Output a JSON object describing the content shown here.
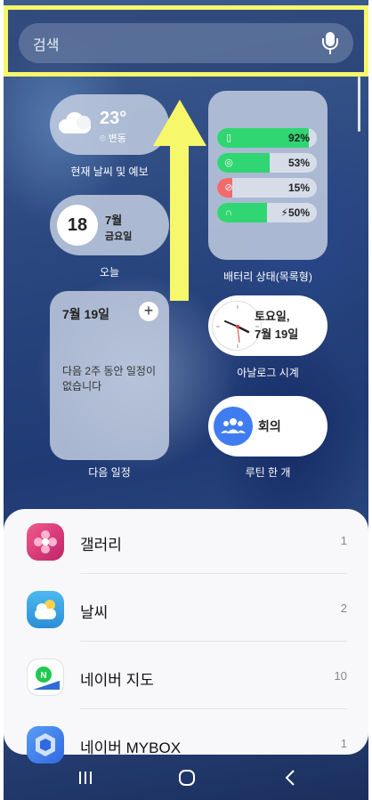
{
  "search": {
    "label": "검색",
    "mic_icon": "mic-icon"
  },
  "widgets": {
    "weather": {
      "temp": "23°",
      "location": "변동",
      "caption": "현재 날씨 및 예보"
    },
    "today": {
      "day": "18",
      "month": "7월",
      "weekday": "금요일",
      "caption": "오늘"
    },
    "schedule": {
      "title": "7월 19일",
      "add": "+",
      "empty": "다음 2주 동안 일정이 없습니다",
      "caption": "다음 일정"
    },
    "battery": {
      "caption": "배터리 상태(목록형)",
      "items": [
        {
          "icon": "phone-icon",
          "pct": "92%",
          "level": 0.92,
          "low": false
        },
        {
          "icon": "watch-icon",
          "pct": "53%",
          "level": 0.53,
          "low": false
        },
        {
          "icon": "pen-icon",
          "pct": "15%",
          "level": 0.15,
          "low": true
        },
        {
          "icon": "earbuds-icon",
          "pct": "⚡50%",
          "level": 0.5,
          "low": false
        }
      ]
    },
    "clock": {
      "line1": "토요일,",
      "line2": "7월 19일",
      "caption": "아날로그 시계"
    },
    "routine": {
      "name": "회의",
      "caption": "루틴 한 개"
    }
  },
  "apps": [
    {
      "name": "갤러리",
      "count": "1",
      "icon": "gallery-icon",
      "color": "#e8407a"
    },
    {
      "name": "날씨",
      "count": "2",
      "icon": "weather-icon",
      "color": "#3aa7e6"
    },
    {
      "name": "네이버 지도",
      "count": "10",
      "icon": "naver-map-icon",
      "color": "#ffffff"
    },
    {
      "name": "네이버 MYBOX",
      "count": "1",
      "icon": "naver-mybox-icon",
      "color": "#3f7cf0"
    }
  ],
  "nav": {
    "recents": "|||",
    "home": "○",
    "back": "<"
  },
  "colors": {
    "highlight": "#f7f76b",
    "battery_green": "#2fd672",
    "battery_red": "#f26b6b"
  }
}
